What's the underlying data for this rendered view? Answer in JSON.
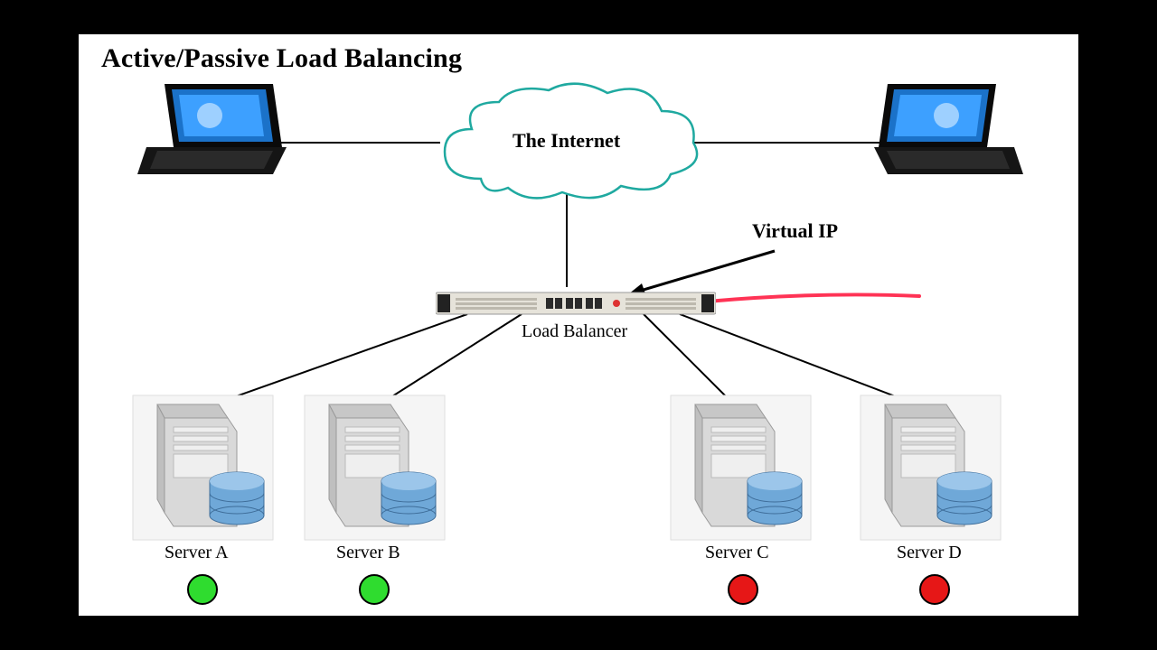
{
  "title": "Active/Passive Load Balancing",
  "cloud_label": "The Internet",
  "vip_label": "Virtual IP",
  "lb_label": "Load Balancer",
  "servers": [
    {
      "name": "Server A",
      "status": "active",
      "color": "#2fdc2f"
    },
    {
      "name": "Server B",
      "status": "active",
      "color": "#2fdc2f"
    },
    {
      "name": "Server C",
      "status": "passive",
      "color": "#e61717"
    },
    {
      "name": "Server D",
      "status": "passive",
      "color": "#e61717"
    }
  ]
}
